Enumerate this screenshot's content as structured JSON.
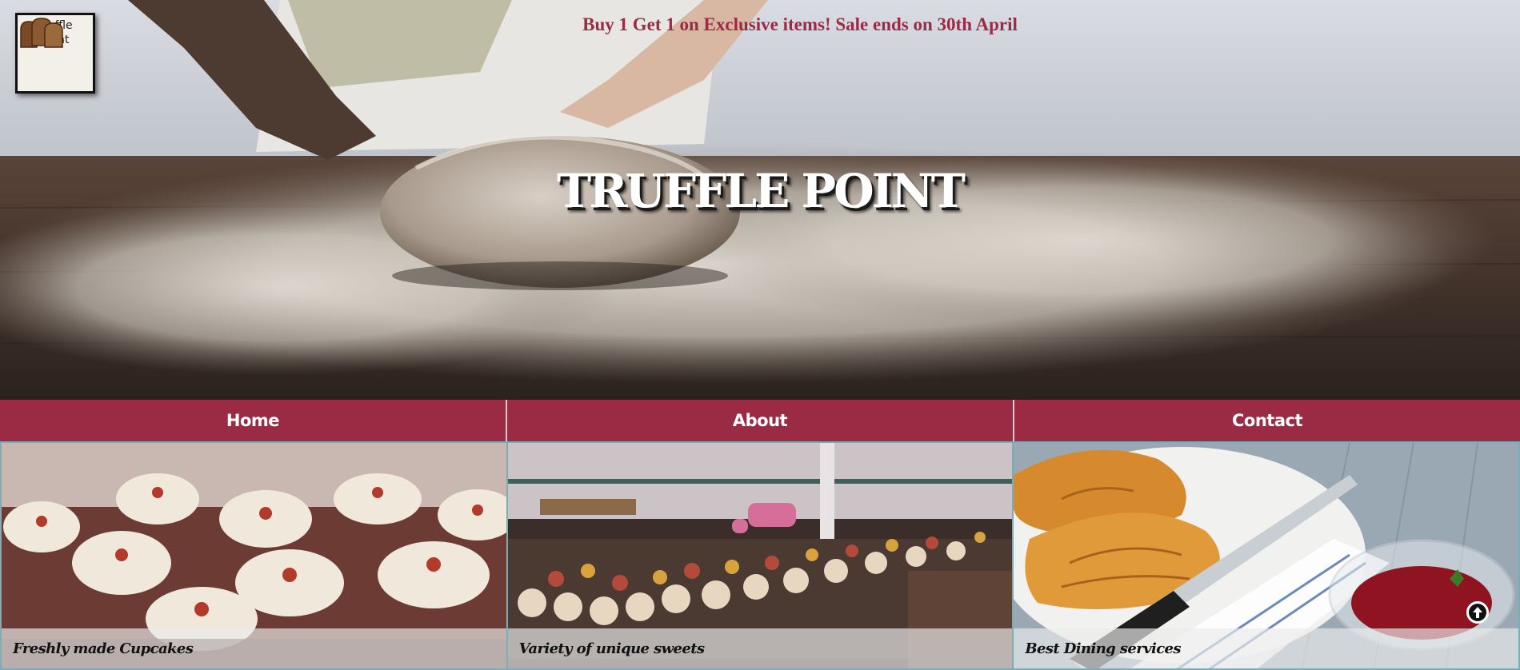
{
  "logo": {
    "line1": "Truffle",
    "line2": "Point"
  },
  "promo": {
    "text": "Buy 1 Get 1 on Exclusive items! Sale ends on 30th April"
  },
  "hero": {
    "title": "TRUFFLE POINT"
  },
  "nav": {
    "items": [
      "Home",
      "About",
      "Contact"
    ]
  },
  "cards": [
    {
      "caption": "Freshly made Cupcakes"
    },
    {
      "caption": "Variety of unique sweets"
    },
    {
      "caption": "Best Dining services"
    }
  ],
  "colors": {
    "accent": "#9b2a44",
    "border": "#7aaeb6",
    "caption_bg": "#ebebeb"
  },
  "icons": {
    "scroll_top": "arrow-circle-up-icon",
    "logo": "bread-loaf-icon"
  }
}
